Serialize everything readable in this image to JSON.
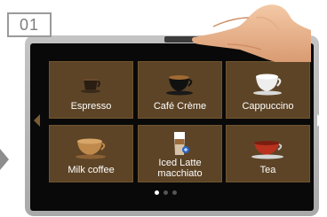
{
  "step": {
    "number": "01"
  },
  "menu": {
    "tiles": [
      {
        "label": "Espresso"
      },
      {
        "label": "Café Crème"
      },
      {
        "label": "Cappuccino"
      },
      {
        "label": "Milk coffee"
      },
      {
        "label": "Iced Latte macchiato"
      },
      {
        "label": "Tea"
      }
    ]
  },
  "pagination": {
    "current_page": 1,
    "total_pages": 3
  },
  "colors": {
    "tile": "#5d4426",
    "screen": "#090909",
    "frame": "#b5b5b5"
  },
  "icons": [
    "chevron-left-icon",
    "chevron-right-icon",
    "hand-pointer-icon"
  ]
}
